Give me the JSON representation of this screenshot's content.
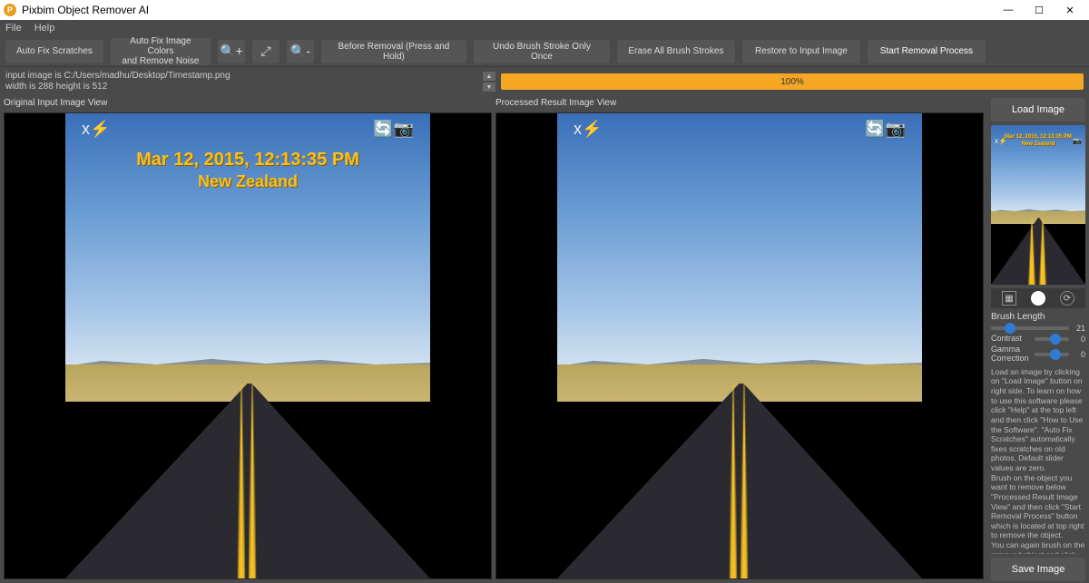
{
  "title": "Pixbim Object Remover AI",
  "menu": {
    "file": "File",
    "help": "Help"
  },
  "toolbar": {
    "auto_fix_scratches": "Auto Fix Scratches",
    "auto_fix_colors": "Auto Fix Image Colors\nand Remove Noise",
    "before_removal": "Before Removal (Press and Hold)",
    "undo_brush": "Undo Brush Stroke Only Once",
    "erase_all": "Erase All Brush Strokes",
    "restore": "Restore to Input Image",
    "start_removal": "Start Removal Process"
  },
  "status": {
    "line1": "input image is C:/Users/madhu/Desktop/Timestamp.png",
    "line2": "width is 288 height is 512",
    "progress": "100%"
  },
  "views": {
    "left_label": "Original Input Image View",
    "right_label": "Processed Result Image View"
  },
  "overlay": {
    "timestamp": "Mar 12, 2015, 12:13:35 PM",
    "location": "New Zealand"
  },
  "right": {
    "load_image": "Load Image",
    "save_image": "Save Image",
    "brush_length_label": "Brush Length",
    "brush_length_value": "21",
    "contrast_label": "Contrast",
    "contrast_value": "0",
    "gamma_label": "Gamma Correction",
    "gamma_value": "0",
    "help_text": "Load an image by clicking on \"Load Image\" button on right side. To learn on how to use this software please click \"Help\" at the top left and then click \"How to Use the Software\". \"Auto Fix Scratches\" automatically fixes scratches on old photos. Default slider values are zero.\nBrush on the object you want to remove below \"Processed Result Image View\" and then click \"Start Removal Process\" button which is located at top right to remove the object.\n You can again brush on the removed object and click removal button to improve the result until the object is removed completely.\npixbim.com"
  },
  "icons": {
    "flash": "x⚡",
    "camera": "📷",
    "zoom_in": "⊕",
    "expand": "⤢",
    "zoom_out": "⊖"
  }
}
